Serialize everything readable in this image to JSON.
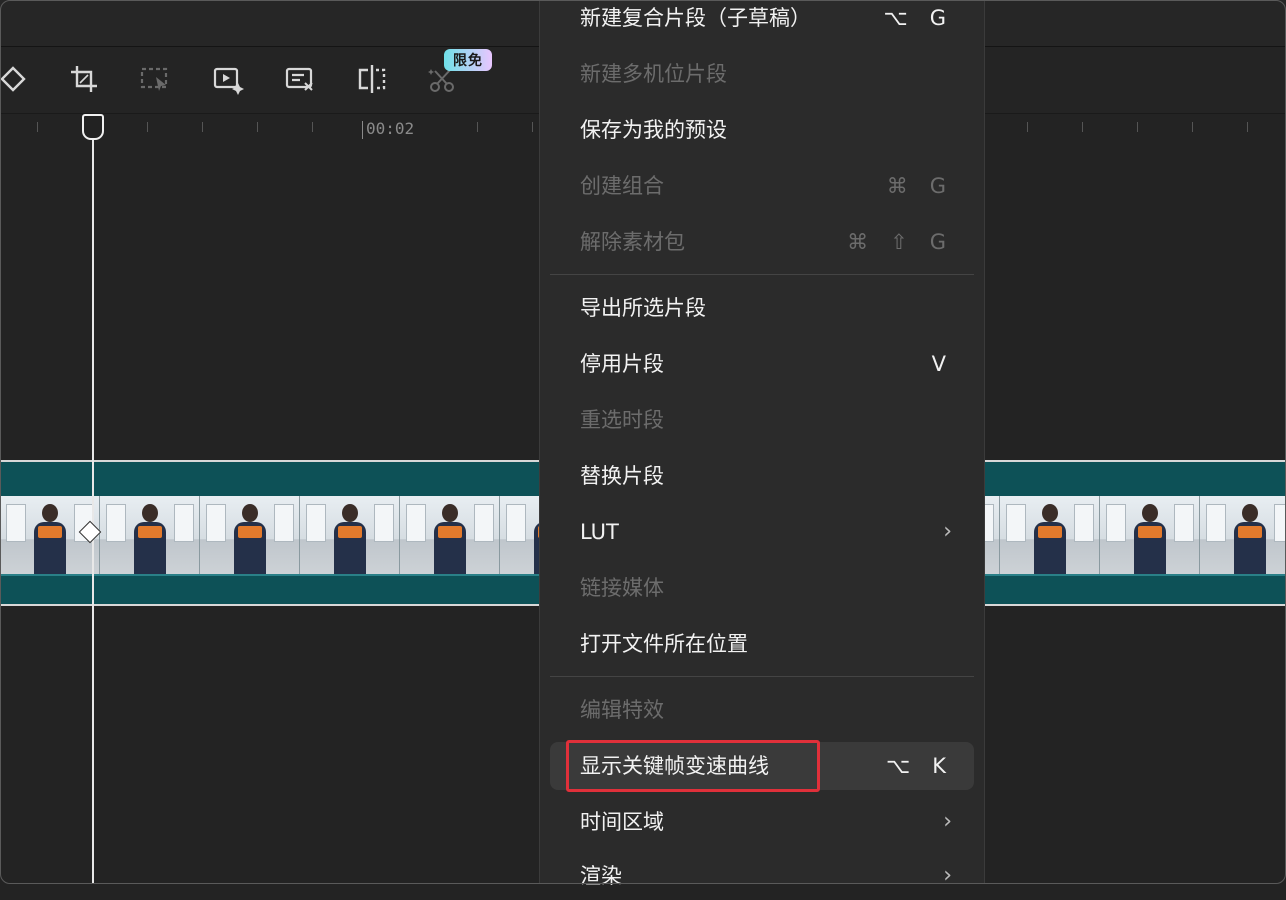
{
  "toolbar": {
    "badge": "限免",
    "tools": [
      "rotate-icon",
      "crop-icon",
      "select-area-icon",
      "smart-video-icon",
      "caption-edit-icon",
      "split-mirror-icon",
      "smart-cut-icon"
    ]
  },
  "timeline": {
    "timecode": "00:02",
    "track_color": "#0d5157"
  },
  "menu": {
    "items": [
      {
        "label": "新建复合片段（子草稿）",
        "shortcut": [
          "⌥",
          "G"
        ],
        "enabled": true
      },
      {
        "label": "新建多机位片段",
        "shortcut": [],
        "enabled": false
      },
      {
        "label": "保存为我的预设",
        "shortcut": [],
        "enabled": true
      },
      {
        "label": "创建组合",
        "shortcut": [
          "⌘",
          "G"
        ],
        "enabled": false
      },
      {
        "label": "解除素材包",
        "shortcut": [
          "⌘",
          "⇧",
          "G"
        ],
        "enabled": false
      },
      {
        "label": "导出所选片段",
        "shortcut": [],
        "enabled": true
      },
      {
        "label": "停用片段",
        "shortcut": [
          "V"
        ],
        "enabled": true
      },
      {
        "label": "重选时段",
        "shortcut": [],
        "enabled": false
      },
      {
        "label": "替换片段",
        "shortcut": [],
        "enabled": true
      },
      {
        "label": "LUT",
        "shortcut": [],
        "enabled": true,
        "submenu": true
      },
      {
        "label": "链接媒体",
        "shortcut": [],
        "enabled": false
      },
      {
        "label": "打开文件所在位置",
        "shortcut": [],
        "enabled": true
      },
      {
        "label": "编辑特效",
        "shortcut": [],
        "enabled": false
      },
      {
        "label": "显示关键帧变速曲线",
        "shortcut": [
          "⌥",
          "K"
        ],
        "enabled": true,
        "highlighted": true
      },
      {
        "label": "时间区域",
        "shortcut": [],
        "enabled": true,
        "submenu": true
      },
      {
        "label": "渲染",
        "shortcut": [],
        "enabled": true,
        "submenu": true
      }
    ],
    "chevron": "›"
  },
  "colors": {
    "accent_highlight": "#e0303a",
    "badge_gradient_start": "#6fe0e8",
    "badge_gradient_end": "#e9c6ff"
  }
}
